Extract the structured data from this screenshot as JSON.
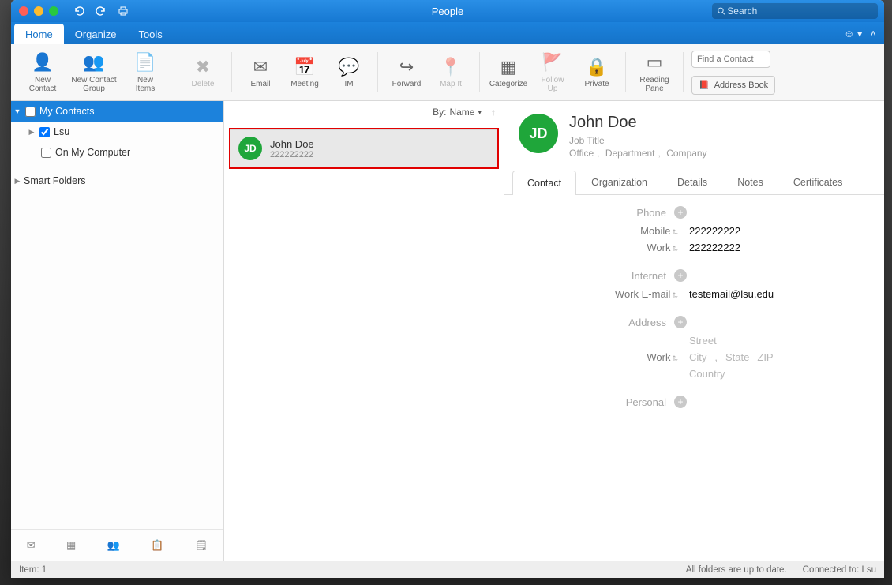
{
  "title": "People",
  "search_placeholder": "Search",
  "tabs": {
    "home": "Home",
    "organize": "Organize",
    "tools": "Tools"
  },
  "ribbon": {
    "new_contact": "New\nContact",
    "new_contact_group": "New Contact\nGroup",
    "new_items": "New\nItems",
    "delete": "Delete",
    "email": "Email",
    "meeting": "Meeting",
    "im": "IM",
    "forward": "Forward",
    "map_it": "Map It",
    "categorize": "Categorize",
    "follow_up": "Follow\nUp",
    "private": "Private",
    "reading_pane": "Reading\nPane",
    "find_contact_ph": "Find a Contact",
    "address_book": "Address Book"
  },
  "sidebar": {
    "my_contacts": "My Contacts",
    "lsu": "Lsu",
    "on_my_computer": "On My Computer",
    "smart_folders": "Smart Folders"
  },
  "list": {
    "sort_label": "By:",
    "sort_value": "Name",
    "contacts": [
      {
        "initials": "JD",
        "name": "John Doe",
        "phone": "222222222"
      }
    ]
  },
  "detail": {
    "initials": "JD",
    "name": "John  Doe",
    "job_title": "Job Title",
    "office": "Office",
    "department": "Department",
    "company": "Company",
    "tabs": {
      "contact": "Contact",
      "organization": "Organization",
      "details": "Details",
      "notes": "Notes",
      "certificates": "Certificates"
    },
    "sections": {
      "phone": {
        "label": "Phone",
        "fields": [
          {
            "label": "Mobile",
            "value": "222222222"
          },
          {
            "label": "Work",
            "value": "222222222"
          }
        ]
      },
      "internet": {
        "label": "Internet",
        "fields": [
          {
            "label": "Work E-mail",
            "value": "testemail@lsu.edu"
          }
        ]
      },
      "address": {
        "label": "Address",
        "work_label": "Work",
        "placeholders": {
          "street": "Street",
          "city": "City",
          "state": "State",
          "zip": "ZIP",
          "country": "Country"
        }
      },
      "personal": {
        "label": "Personal"
      }
    }
  },
  "status": {
    "item_count": "Item: 1",
    "sync": "All folders are up to date.",
    "connection": "Connected to: Lsu"
  }
}
